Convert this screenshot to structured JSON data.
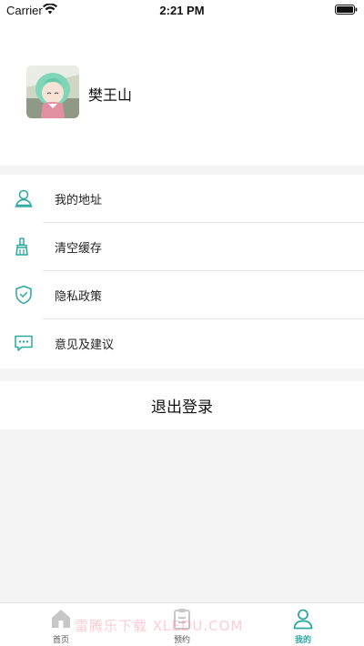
{
  "status_bar": {
    "carrier": "Carrier",
    "time": "2:21 PM",
    "icons": [
      "wifi-icon",
      "battery-icon"
    ]
  },
  "profile": {
    "username": "樊王山",
    "avatar_icon": "avatar-anime-girl"
  },
  "menu": {
    "items": [
      {
        "label": "我的地址",
        "icon": "user-location-icon"
      },
      {
        "label": "清空缓存",
        "icon": "broom-icon"
      },
      {
        "label": "隐私政策",
        "icon": "shield-check-icon"
      },
      {
        "label": "意见及建议",
        "icon": "chat-bubble-icon"
      }
    ]
  },
  "logout": {
    "label": "退出登录"
  },
  "tab_bar": {
    "tabs": [
      {
        "label": "首页",
        "icon": "home-icon",
        "active": false
      },
      {
        "label": "预约",
        "icon": "clipboard-icon",
        "active": false
      },
      {
        "label": "我的",
        "icon": "user-icon",
        "active": true
      }
    ]
  },
  "watermark": "雷腾乐下载 XLEDU.COM",
  "colors": {
    "accent": "#2aa8a0",
    "background": "#f4f4f4"
  }
}
